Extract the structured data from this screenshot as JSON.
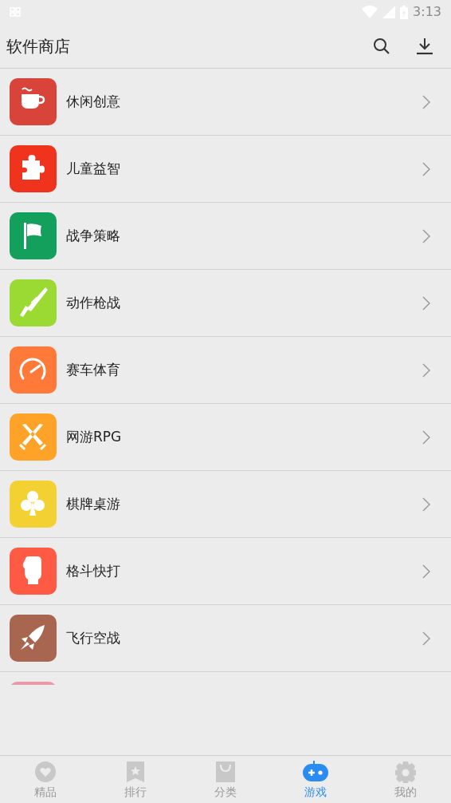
{
  "status_bar": {
    "time": "3:13"
  },
  "header": {
    "title": "软件商店"
  },
  "categories": [
    {
      "label": "休闲创意",
      "kind": "cup",
      "color": "#d8433a"
    },
    {
      "label": "儿童益智",
      "kind": "puzzle",
      "color": "#f0331c"
    },
    {
      "label": "战争策略",
      "kind": "flag",
      "color": "#12a05c"
    },
    {
      "label": "动作枪战",
      "kind": "rifle",
      "color": "#9bd933"
    },
    {
      "label": "赛车体育",
      "kind": "gauge",
      "color": "#ff7a38"
    },
    {
      "label": "网游RPG",
      "kind": "swords",
      "color": "#ffa328"
    },
    {
      "label": "棋牌桌游",
      "kind": "club",
      "color": "#f3d133"
    },
    {
      "label": "格斗快打",
      "kind": "fist",
      "color": "#ff5a44"
    },
    {
      "label": "飞行空战",
      "kind": "rocket",
      "color": "#a8654f"
    },
    {
      "kind": "cut",
      "color": "#e89aa8"
    }
  ],
  "bottom_nav": [
    {
      "label": "精品",
      "kind": "heart",
      "selected": false
    },
    {
      "label": "排行",
      "kind": "bookmark",
      "selected": false
    },
    {
      "label": "分类",
      "kind": "bag",
      "selected": false
    },
    {
      "label": "游戏",
      "kind": "gamepad",
      "selected": true
    },
    {
      "label": "我的",
      "kind": "gear",
      "selected": false
    }
  ]
}
